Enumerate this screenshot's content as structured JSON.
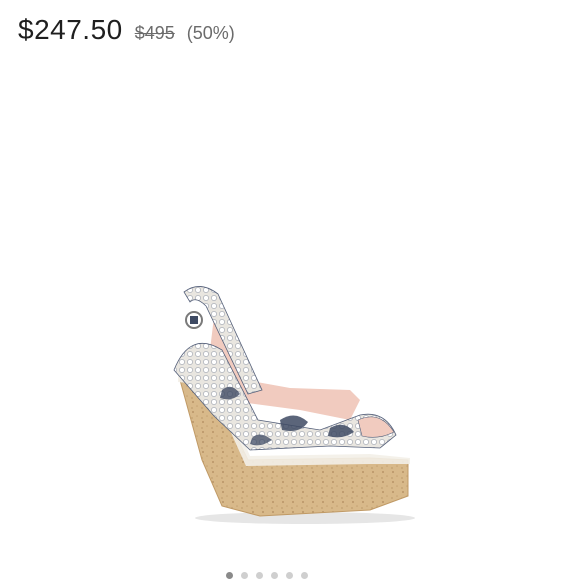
{
  "price": {
    "current": "$247.50",
    "original": "$495",
    "discount": "(50%)"
  },
  "product": {
    "image_alt": "",
    "pattern": "snakeskin",
    "colors": {
      "cork": "#d8b98a",
      "cork_dark": "#c09a66",
      "lining": "#f1cbbf",
      "snake_light": "#e9e6e0",
      "snake_dark": "#3e4a63"
    }
  },
  "carousel": {
    "dot_count": 6,
    "active_index": 0
  }
}
